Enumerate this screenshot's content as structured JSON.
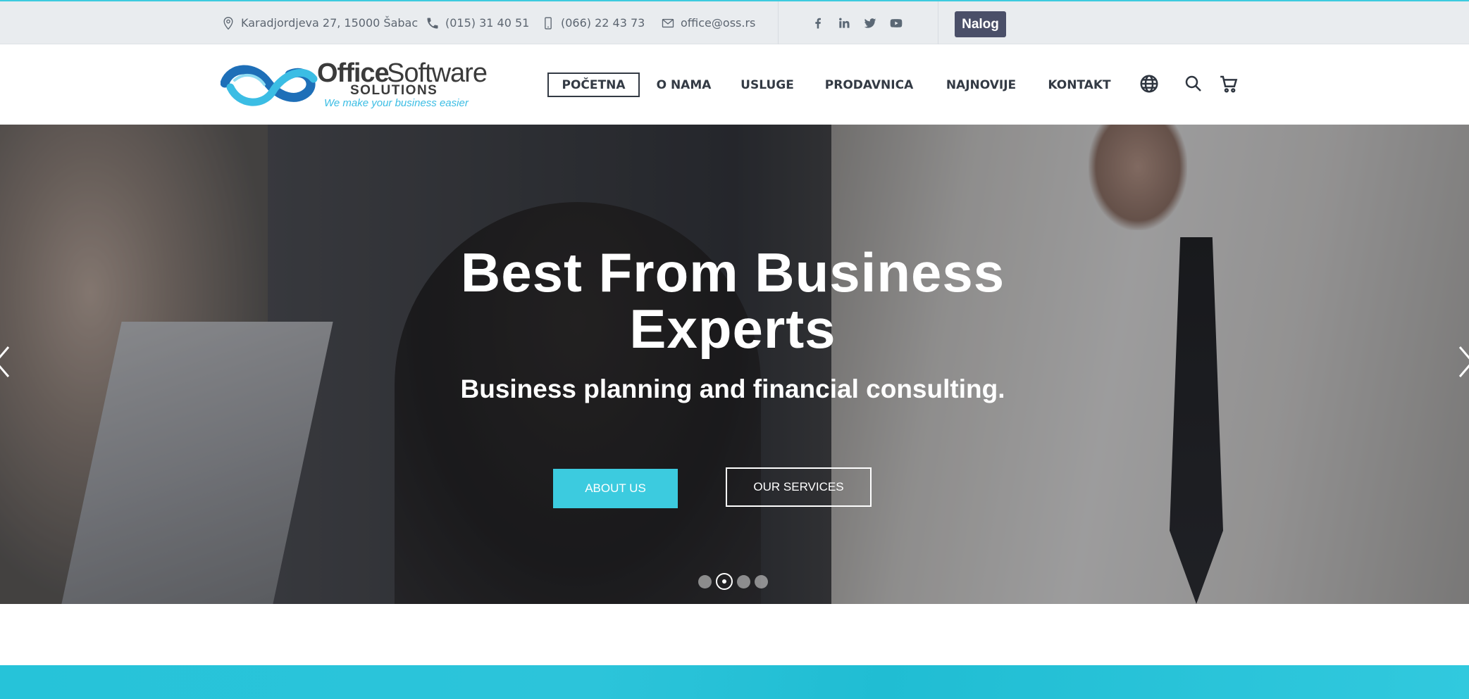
{
  "topbar": {
    "address": "Karadjordjeva 27, 15000 Šabac",
    "phone": "(015) 31 40 51",
    "mobile": "(066) 22 43 73",
    "email": "office@oss.rs",
    "social_icons": [
      "facebook-icon",
      "linkedin-icon",
      "twitter-icon",
      "youtube-icon"
    ],
    "account_label": "Nalog"
  },
  "logo": {
    "brand_bold": "Office",
    "brand_regular": "Software",
    "brand_sub": "SOLUTIONS",
    "tagline": "We make your business easier"
  },
  "nav": {
    "items": [
      {
        "label": "POČETNA",
        "active": true
      },
      {
        "label": "O NAMA",
        "active": false
      },
      {
        "label": "USLUGE",
        "active": false
      },
      {
        "label": "PRODAVNICA",
        "active": false
      },
      {
        "label": "NAJNOVIJE",
        "active": false
      },
      {
        "label": "KONTAKT",
        "active": false
      }
    ],
    "icons": [
      "globe-icon",
      "search-icon",
      "cart-icon"
    ]
  },
  "hero": {
    "title_line1": "Best From Business",
    "title_line2": "Experts",
    "subtitle": "Business planning and financial consulting.",
    "primary_button": "ABOUT US",
    "secondary_button": "OUR SERVICES",
    "slides_total": 4,
    "active_slide": 2
  },
  "colors": {
    "accent": "#3ccbdf",
    "account_button": "#4a4f68",
    "nav_text": "#333a44",
    "topbar_bg": "#e9ecef"
  }
}
